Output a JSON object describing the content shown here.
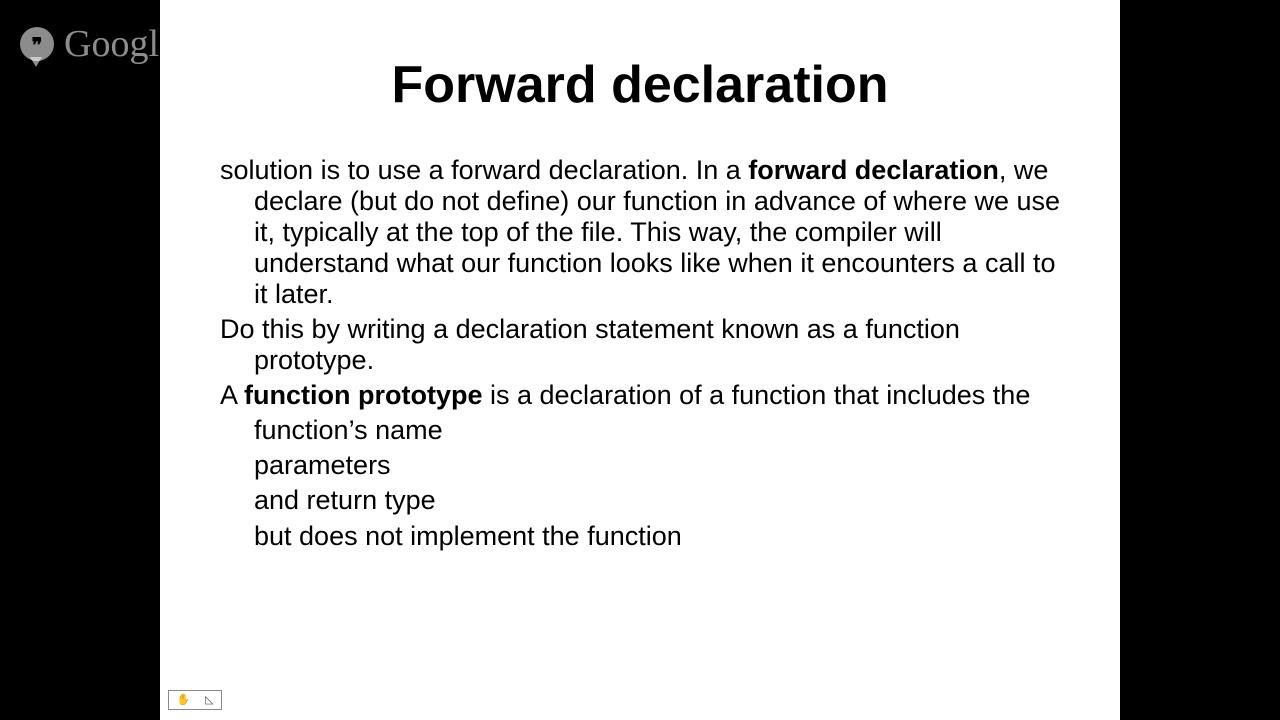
{
  "watermark": {
    "brand": "Google",
    "suffix": "+"
  },
  "slide": {
    "title": "Forward declaration",
    "p1_a": "solution is to use a forward declaration. In a ",
    "p1_bold": "forward declaration",
    "p1_b": ", we declare (but do not define) our function in advance of where we use it, typically at the top of the file. This way, the compiler will understand what our function looks like when it encounters a call to it later.",
    "p2": "Do this by writing a declaration statement known as a function prototype.",
    "p3_a": "A ",
    "p3_bold": "function prototype",
    "p3_b": " is a declaration of a function that includes the",
    "items": {
      "i1": "function’s name",
      "i2": "parameters",
      "i3": "and return type",
      "i4": "but does not implement the function"
    }
  },
  "toolbar": {
    "hand": "✋",
    "pen": "◺"
  }
}
